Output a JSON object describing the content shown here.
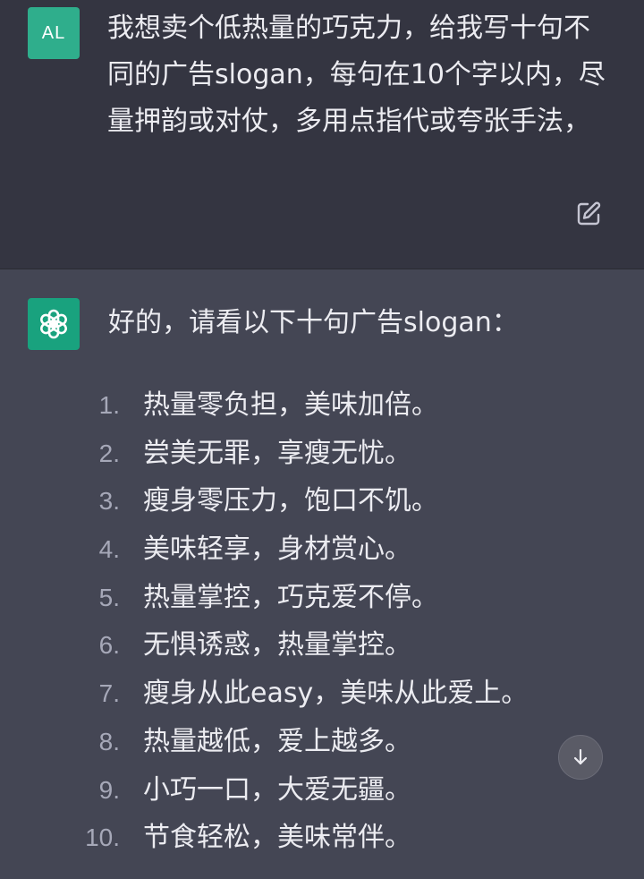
{
  "user_message": {
    "avatar_initials": "AL",
    "text": "我想卖个低热量的巧克力，给我写十句不同的广告slogan，每句在10个字以内，尽量押韵或对仗，多用点指代或夸张手法，",
    "avatar_color": "#2fae8c"
  },
  "assistant_message": {
    "intro": "好的，请看以下十句广告slogan：",
    "avatar_color": "#19a27e",
    "slogans": [
      {
        "number": "1.",
        "text": "热量零负担，美味加倍。"
      },
      {
        "number": "2.",
        "text": "尝美无罪，享瘦无忧。"
      },
      {
        "number": "3.",
        "text": "瘦身零压力，饱口不饥。"
      },
      {
        "number": "4.",
        "text": "美味轻享，身材赏心。"
      },
      {
        "number": "5.",
        "text": "热量掌控，巧克爱不停。"
      },
      {
        "number": "6.",
        "text": "无惧诱惑，热量掌控。"
      },
      {
        "number": "7.",
        "text": "瘦身从此easy，美味从此爱上。"
      },
      {
        "number": "8.",
        "text": "热量越低，爱上越多。"
      },
      {
        "number": "9.",
        "text": "小巧一口，大爱无疆。"
      },
      {
        "number": "10.",
        "text": "节食轻松，美味常伴。"
      }
    ]
  },
  "icons": {
    "edit": "edit-icon",
    "assistant_logo": "openai-logo-icon",
    "scroll": "arrow-down-icon"
  },
  "colors": {
    "user_bg": "#343541",
    "assistant_bg": "#444654",
    "text": "#ececf1",
    "number": "#a6a8b8"
  }
}
